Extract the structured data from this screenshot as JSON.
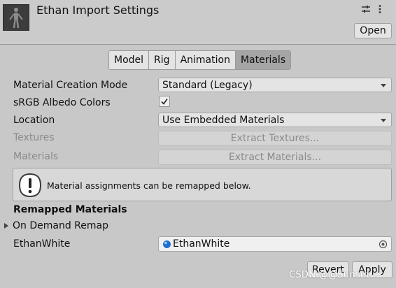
{
  "header": {
    "title": "Ethan Import Settings",
    "open_label": "Open",
    "icons": [
      "sliders-icon",
      "more-icon"
    ]
  },
  "tabs": [
    {
      "label": "Model",
      "active": false
    },
    {
      "label": "Rig",
      "active": false
    },
    {
      "label": "Animation",
      "active": false
    },
    {
      "label": "Materials",
      "active": true
    }
  ],
  "fields": {
    "material_creation_mode": {
      "label": "Material Creation Mode",
      "value": "Standard (Legacy)"
    },
    "srgb_albedo": {
      "label": "sRGB Albedo Colors",
      "checked": true
    },
    "location": {
      "label": "Location",
      "value": "Use Embedded Materials"
    },
    "textures": {
      "label": "Textures",
      "button": "Extract Textures..."
    },
    "materials": {
      "label": "Materials",
      "button": "Extract Materials..."
    }
  },
  "help": {
    "message": "Material assignments can be remapped below."
  },
  "remapped": {
    "title": "Remapped Materials",
    "foldout": "On Demand Remap",
    "entry_label": "EthanWhite",
    "entry_value": "EthanWhite"
  },
  "footer": {
    "revert_label": "Revert",
    "apply_label": "Apply"
  },
  "watermark": "CSDN @@Sunset...",
  "colors": {
    "active_tab": "#a5a5a5",
    "background": "#c8c8c8",
    "material_dot": "#1e6fd0"
  }
}
